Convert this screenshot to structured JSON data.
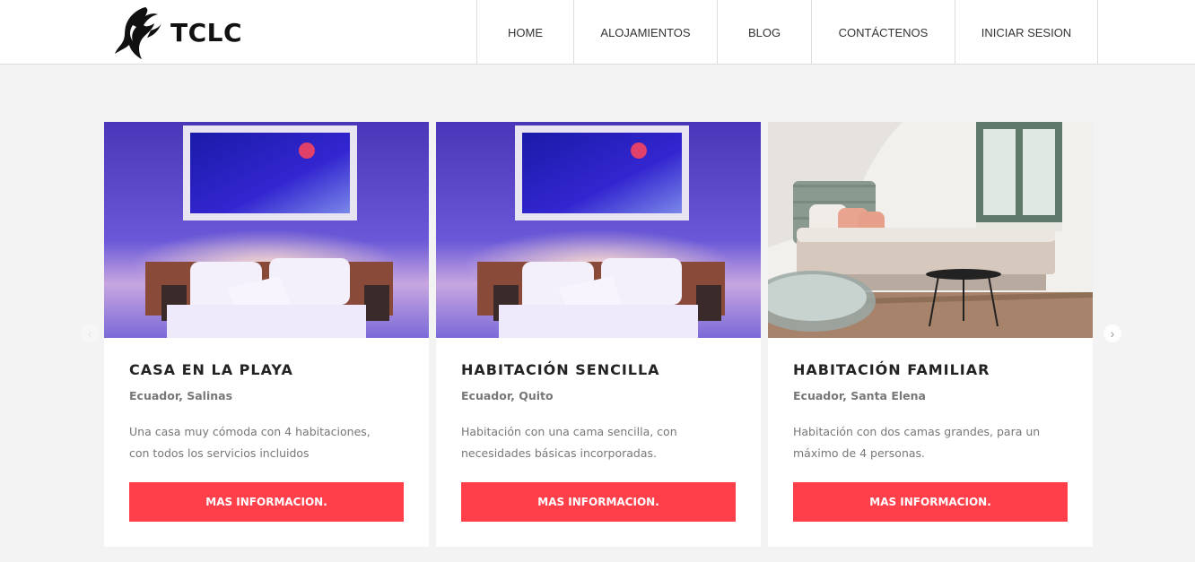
{
  "brand": {
    "name": "TCLC",
    "logo_icon": "stylized-flame-leaf-icon"
  },
  "nav": {
    "items": [
      {
        "label": "HOME"
      },
      {
        "label": "ALOJAMIENTOS"
      },
      {
        "label": "BLOG"
      },
      {
        "label": "CONTÁCTENOS"
      },
      {
        "label": "INICIAR SESION"
      }
    ]
  },
  "carousel": {
    "prev_icon": "chevron-left-icon",
    "next_icon": "chevron-right-icon",
    "cards": [
      {
        "image": "purple-lit-bedroom-photo",
        "title": "CASA EN LA PLAYA",
        "location": "Ecuador, Salinas",
        "description": "Una casa muy cómoda con 4 habitaciones, con todos los servicios incluidos",
        "button": "MAS INFORMACION."
      },
      {
        "image": "purple-lit-bedroom-photo",
        "title": "HABITACIÓN SENCILLA",
        "location": "Ecuador, Quito",
        "description": "Habitación con una cama sencilla, con necesidades básicas incorporadas.",
        "button": "MAS INFORMACION."
      },
      {
        "image": "bright-bedroom-window-photo",
        "title": "HABITACIÓN FAMILIAR",
        "location": "Ecuador, Santa Elena",
        "description": "Habitación con dos camas grandes, para un máximo de 4 personas.",
        "button": "MAS INFORMACION."
      }
    ]
  },
  "colors": {
    "accent": "#ff3f4a",
    "background": "#f3f3f3"
  }
}
